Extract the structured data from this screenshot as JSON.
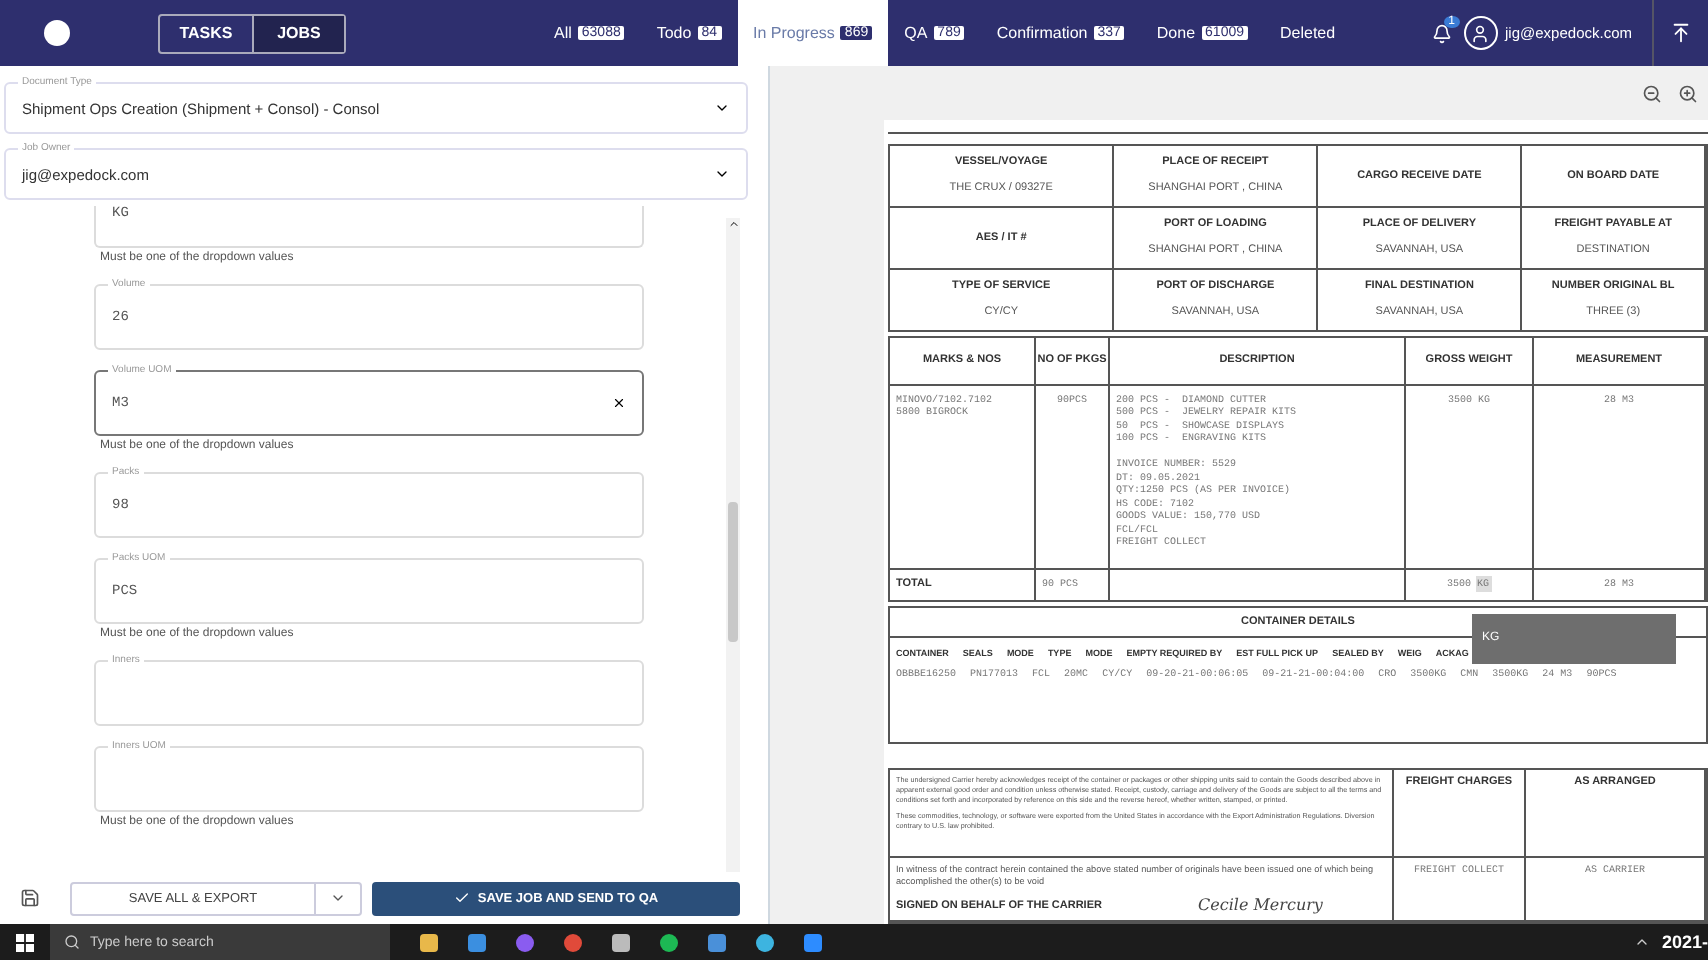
{
  "nav": {
    "mode_toggle": [
      {
        "label": "TASKS",
        "selected": false
      },
      {
        "label": "JOBS",
        "selected": true
      }
    ],
    "tabs": [
      {
        "label": "All",
        "count": "63088",
        "selected": false
      },
      {
        "label": "Todo",
        "count": "84",
        "selected": false
      },
      {
        "label": "In Progress",
        "count": "869",
        "selected": true
      },
      {
        "label": "QA",
        "count": "789",
        "selected": false
      },
      {
        "label": "Confirmation",
        "count": "337",
        "selected": false
      },
      {
        "label": "Done",
        "count": "61009",
        "selected": false
      },
      {
        "label": "Deleted",
        "selected": false
      }
    ],
    "notification_count": "1",
    "user_email": "jig@expedock.com"
  },
  "form": {
    "selects": [
      {
        "label": "Document Type",
        "value": "Shipment Ops Creation (Shipment + Consol) - Consol"
      },
      {
        "label": "Job Owner",
        "value": "jig@expedock.com"
      }
    ],
    "fields": [
      {
        "kind": "cut",
        "value": "KG",
        "focused": false,
        "helper": "Must be one of the dropdown values"
      },
      {
        "kind": "field",
        "label": "Volume",
        "value": "26",
        "focused": false
      },
      {
        "kind": "field",
        "label": "Volume UOM",
        "value": "M3",
        "focused": true,
        "clearable": true,
        "helper": "Must be one of the dropdown values"
      },
      {
        "kind": "field",
        "label": "Packs",
        "value": "98",
        "focused": false
      },
      {
        "kind": "field",
        "label": "Packs UOM",
        "value": "PCS",
        "focused": false,
        "helper": "Must be one of the dropdown values"
      },
      {
        "kind": "field",
        "label": "Inners",
        "focused": false
      },
      {
        "kind": "field",
        "label": "Inners UOM",
        "focused": false,
        "helper": "Must be one of the dropdown values"
      }
    ],
    "buttons": {
      "export": "SAVE ALL & EXPORT",
      "send": "SAVE JOB AND SEND TO QA"
    }
  },
  "document": {
    "header_rows": [
      [
        {
          "label": "VESSEL/VOYAGE",
          "value": "THE CRUX / 09327E"
        },
        {
          "label": "PLACE OF RECEIPT",
          "value": "SHANGHAI PORT , CHINA"
        },
        {
          "label": "CARGO RECEIVE DATE"
        },
        {
          "label": "ON BOARD DATE"
        }
      ],
      [
        {
          "label": "AES / IT #"
        },
        {
          "label": "PORT OF LOADING",
          "value": "SHANGHAI PORT , CHINA"
        },
        {
          "label": "PLACE OF DELIVERY",
          "value": "SAVANNAH, USA"
        },
        {
          "label": "FREIGHT PAYABLE AT",
          "value": "DESTINATION"
        }
      ],
      [
        {
          "label": "TYPE OF SERVICE",
          "value": "CY/CY"
        },
        {
          "label": "PORT OF DISCHARGE",
          "value": "SAVANNAH, USA"
        },
        {
          "label": "FINAL DESTINATION",
          "value": "SAVANNAH, USA"
        },
        {
          "label": "NUMBER ORIGINAL BL",
          "value": "THREE (3)"
        }
      ]
    ],
    "cargo": {
      "columns": [
        "MARKS & NOS",
        "NO OF PKGS",
        "DESCRIPTION",
        "GROSS WEIGHT",
        "MEASUREMENT"
      ],
      "row": {
        "marks": [
          "MINOVO/7102.7102",
          "5800 BIGROCK"
        ],
        "pkgs": "90PCS",
        "description": [
          "200 PCS -  DIAMOND CUTTER",
          "500 PCS -  JEWELRY REPAIR KITS",
          "50  PCS -  SHOWCASE DISPLAYS",
          "100 PCS -  ENGRAVING KITS"
        ],
        "notes": [
          "INVOICE NUMBER: 5529",
          "DT: 09.05.2021",
          "QTY:1250 PCS (AS PER INVOICE)",
          "HS CODE: 7102",
          "GOODS VALUE: 150,770 USD",
          "FCL/FCL",
          "FREIGHT COLLECT"
        ],
        "weight": "3500 KG",
        "measurement": "28 M3"
      },
      "total": {
        "label": "TOTAL",
        "pkgs": "90 PCS",
        "weight": "3500",
        "weight_unit": "KG",
        "weight_unit_highlighted": true,
        "measurement": "28 M3"
      }
    },
    "containers": {
      "title": "CONTAINER DETAILS",
      "columns": [
        "CONTAINER",
        "SEALS",
        "MODE",
        "TYPE",
        "MODE",
        "EMPTY REQUIRED BY",
        "EST FULL PICK UP",
        "SEALED BY",
        "WEIG",
        "ACKAG"
      ],
      "row": [
        "OBBBE16250",
        "PN177013",
        "FCL",
        "20MC",
        "CY/CY",
        "09-20-21-00:06:05",
        "09-21-21-00:04:00",
        "CRO",
        "3500KG",
        "CMN",
        "3500KG",
        "24 M3",
        "90PCS"
      ],
      "tooltip": "KG"
    },
    "terms": [
      "The undersigned Carrier hereby acknowledges receipt of the container or packages or other shipping units said to contain the Goods described above in apparent external good order and condition unless otherwise stated. Receipt, custody, carriage and delivery of the Goods are subject to all the terms and conditions set forth and incorporated by reference on this side and the reverse hereof, whether written, stamped, or printed.",
      "These commodities, technology, or software were exported from the United States in accordance with the Export Administration Regulations. Diversion contrary to U.S. law prohibited."
    ],
    "charges": [
      {
        "label": "FREIGHT CHARGES",
        "value": "FREIGHT COLLECT"
      },
      {
        "label": "AS ARRANGED",
        "value": "AS CARRIER"
      }
    ],
    "witness": "In witness of the contract herein contained the above stated number of originals have been issued one of which being accomplished the other(s) to be void",
    "signed_label": "SIGNED ON BEHALF OF THE CARRIER",
    "signature": "Cecile Mercury"
  },
  "taskbar": {
    "search_placeholder": "Type here to search",
    "clock": "2021-"
  }
}
